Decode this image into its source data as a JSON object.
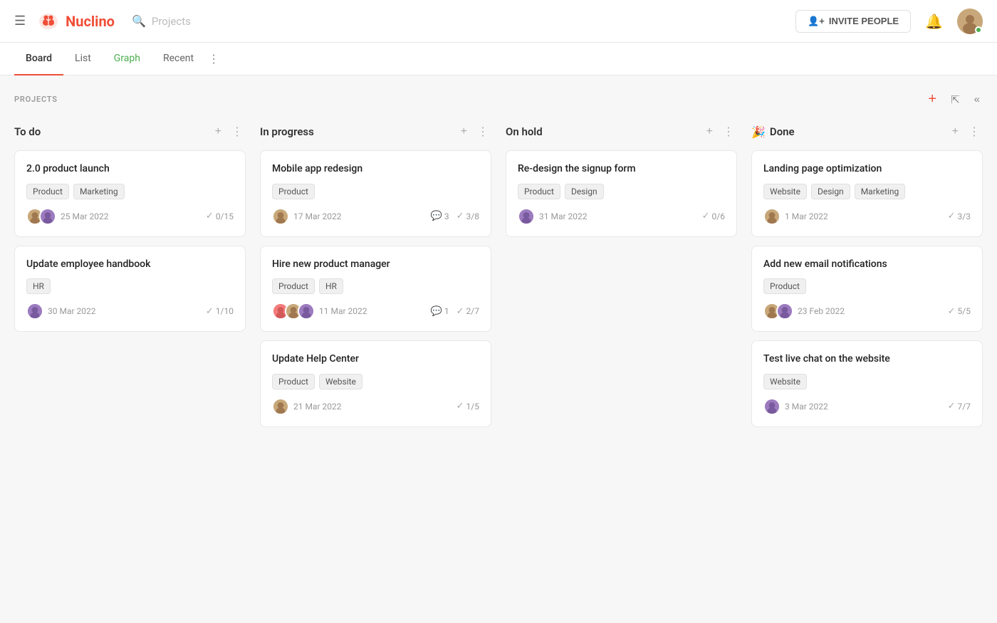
{
  "header": {
    "logo_text": "Nuclino",
    "search_placeholder": "Projects",
    "invite_label": "INVITE PEOPLE",
    "tabs": [
      {
        "id": "board",
        "label": "Board",
        "active": true
      },
      {
        "id": "list",
        "label": "List",
        "active": false
      },
      {
        "id": "graph",
        "label": "Graph",
        "active": false
      },
      {
        "id": "recent",
        "label": "Recent",
        "active": false
      }
    ]
  },
  "projects": {
    "label": "PROJECTS",
    "columns": [
      {
        "id": "todo",
        "title": "To do",
        "emoji": "",
        "cards": [
          {
            "id": "card1",
            "title": "2.0 product launch",
            "tags": [
              "Product",
              "Marketing"
            ],
            "avatars": [
              "a",
              "b"
            ],
            "date": "25 Mar 2022",
            "checks": "0/15",
            "comments": ""
          },
          {
            "id": "card2",
            "title": "Update employee handbook",
            "tags": [
              "HR"
            ],
            "avatars": [
              "b"
            ],
            "date": "30 Mar 2022",
            "checks": "1/10",
            "comments": ""
          }
        ]
      },
      {
        "id": "inprogress",
        "title": "In progress",
        "emoji": "",
        "cards": [
          {
            "id": "card3",
            "title": "Mobile app redesign",
            "tags": [
              "Product"
            ],
            "avatars": [
              "a"
            ],
            "date": "17 Mar 2022",
            "checks": "3/8",
            "comments": "3"
          },
          {
            "id": "card4",
            "title": "Hire new product manager",
            "tags": [
              "Product",
              "HR"
            ],
            "avatars": [
              "c",
              "a",
              "b"
            ],
            "date": "11 Mar 2022",
            "checks": "2/7",
            "comments": "1"
          },
          {
            "id": "card5",
            "title": "Update Help Center",
            "tags": [
              "Product",
              "Website"
            ],
            "avatars": [
              "a"
            ],
            "date": "21 Mar 2022",
            "checks": "1/5",
            "comments": ""
          }
        ]
      },
      {
        "id": "onhold",
        "title": "On hold",
        "emoji": "",
        "cards": [
          {
            "id": "card6",
            "title": "Re-design the signup form",
            "tags": [
              "Product",
              "Design"
            ],
            "avatars": [
              "b"
            ],
            "date": "31 Mar 2022",
            "checks": "0/6",
            "comments": ""
          }
        ]
      },
      {
        "id": "done",
        "title": "Done",
        "emoji": "🎉",
        "cards": [
          {
            "id": "card7",
            "title": "Landing page optimization",
            "tags": [
              "Website",
              "Design",
              "Marketing"
            ],
            "avatars": [
              "a"
            ],
            "date": "1 Mar 2022",
            "checks": "3/3",
            "comments": ""
          },
          {
            "id": "card8",
            "title": "Add new email notifications",
            "tags": [
              "Product"
            ],
            "avatars": [
              "a",
              "b"
            ],
            "date": "23 Feb 2022",
            "checks": "5/5",
            "comments": ""
          },
          {
            "id": "card9",
            "title": "Test live chat on the website",
            "tags": [
              "Website"
            ],
            "avatars": [
              "b"
            ],
            "date": "3 Mar 2022",
            "checks": "7/7",
            "comments": ""
          }
        ]
      }
    ]
  }
}
